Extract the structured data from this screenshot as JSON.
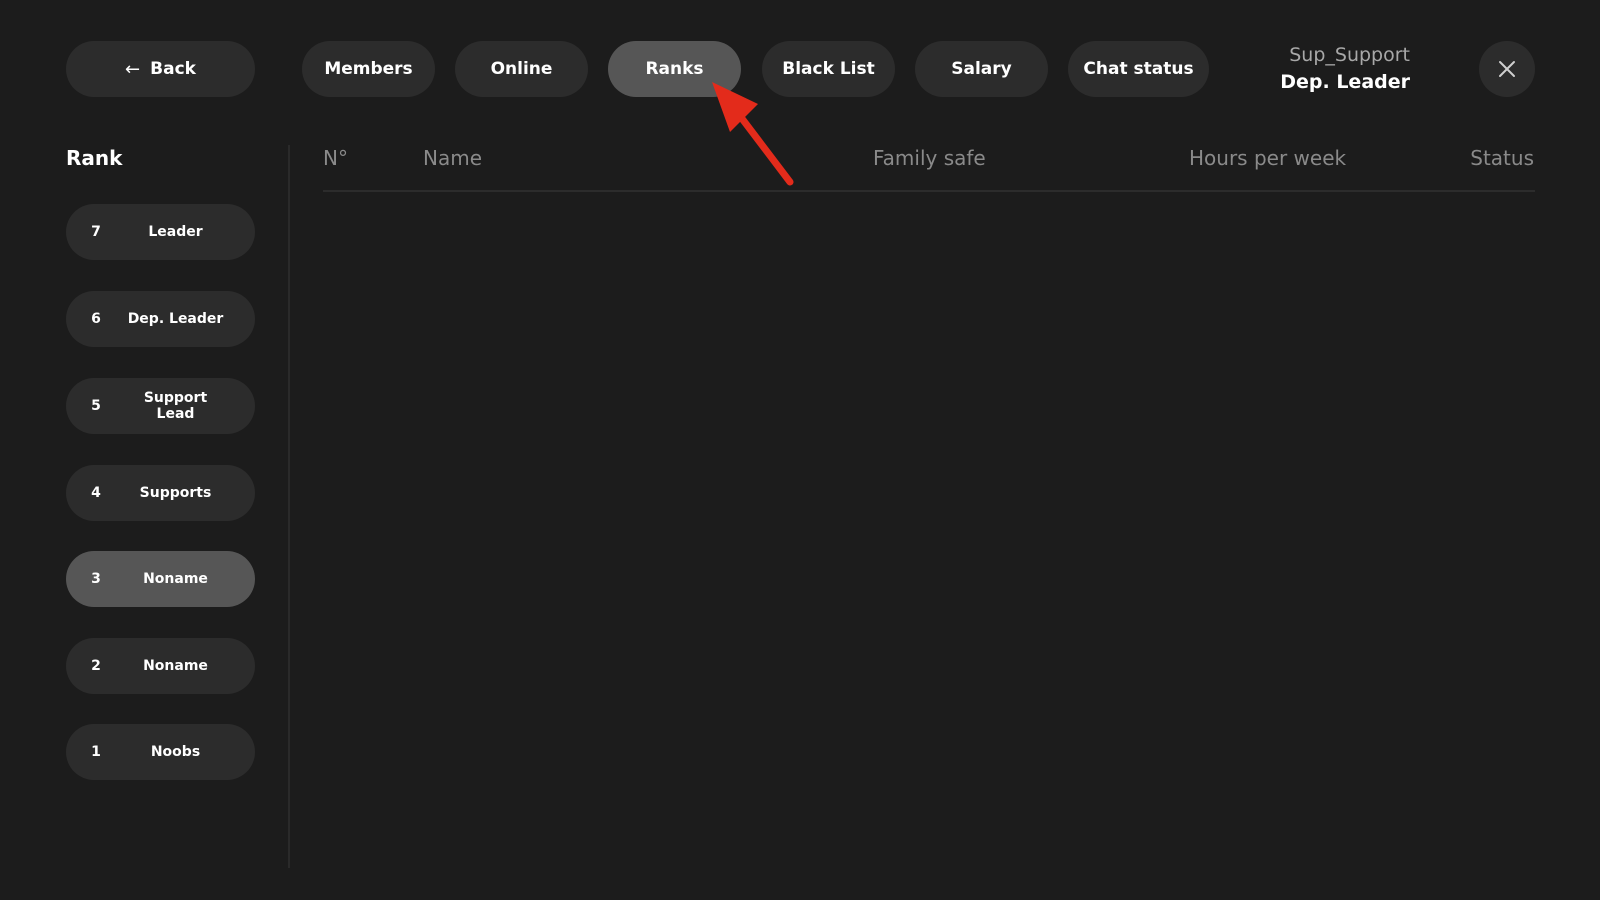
{
  "header": {
    "back_label": "Back",
    "tabs": [
      {
        "label": "Members"
      },
      {
        "label": "Online"
      },
      {
        "label": "Ranks",
        "active": true
      },
      {
        "label": "Black List"
      },
      {
        "label": "Salary"
      },
      {
        "label": "Chat status"
      }
    ],
    "user": {
      "name": "Sup_Support",
      "rank": "Dep. Leader"
    }
  },
  "sidebar": {
    "title": "Rank",
    "items": [
      {
        "num": "7",
        "label": "Leader"
      },
      {
        "num": "6",
        "label": "Dep. Leader"
      },
      {
        "num": "5",
        "label": "Support Lead"
      },
      {
        "num": "4",
        "label": "Supports"
      },
      {
        "num": "3",
        "label": "Noname",
        "active": true
      },
      {
        "num": "2",
        "label": "Noname"
      },
      {
        "num": "1",
        "label": "Noobs"
      }
    ]
  },
  "table": {
    "columns": [
      "N°",
      "Name",
      "Family safe",
      "Hours per week",
      "Status"
    ]
  },
  "colors": {
    "background": "#1c1c1c",
    "pill": "#2c2c2c",
    "active_pill": "#565656",
    "pointer_arrow": "#e32b1b"
  }
}
